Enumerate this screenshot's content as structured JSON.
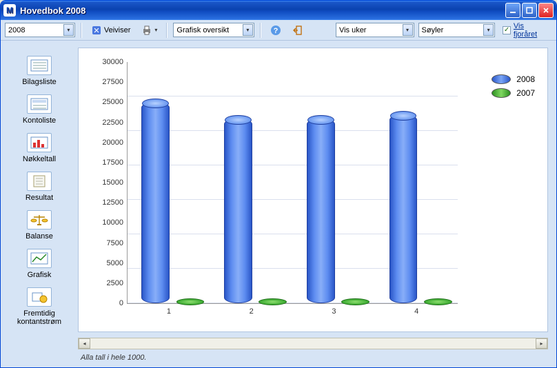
{
  "window": {
    "title": "Hovedbok 2008",
    "app_icon_letter": "M"
  },
  "toolbar": {
    "year_select": "2008",
    "veiviser_label": "Veiviser",
    "view_select": "Grafisk oversikt",
    "period_select": "Vis uker",
    "charttype_select": "Søyler",
    "show_prev_year_checked": true,
    "show_prev_year_label": "Vis fjoråret"
  },
  "sidebar": {
    "items": [
      {
        "key": "bilagsliste",
        "label": "Bilagsliste",
        "icon": "bilagsliste-icon"
      },
      {
        "key": "kontoliste",
        "label": "Kontoliste",
        "icon": "kontoliste-icon"
      },
      {
        "key": "nokkeltall",
        "label": "Nøkkeltall",
        "icon": "nokkeltall-icon"
      },
      {
        "key": "resultat",
        "label": "Resultat",
        "icon": "resultat-icon"
      },
      {
        "key": "balanse",
        "label": "Balanse",
        "icon": "balanse-icon"
      },
      {
        "key": "grafisk",
        "label": "Grafisk",
        "icon": "grafisk-icon"
      },
      {
        "key": "fremtidig",
        "label": "Fremtidig kontantstrøm",
        "icon": "fremtidig-icon"
      }
    ]
  },
  "chart_data": {
    "type": "bar",
    "categories": [
      "1",
      "2",
      "3",
      "4"
    ],
    "series": [
      {
        "name": "2008",
        "color": "#4a78e0",
        "values": [
          25000,
          23000,
          23000,
          23500
        ]
      },
      {
        "name": "2007",
        "color": "#3aa830",
        "values": [
          0,
          0,
          0,
          0
        ]
      }
    ],
    "ylim": [
      0,
      30000
    ],
    "yticks": [
      0,
      2500,
      5000,
      7500,
      10000,
      12500,
      15000,
      17500,
      20000,
      22500,
      25000,
      27500,
      30000
    ],
    "xlabel": "",
    "ylabel": "",
    "title": ""
  },
  "legend": [
    {
      "label": "2008",
      "color": "blue"
    },
    {
      "label": "2007",
      "color": "green"
    }
  ],
  "footer_note": "Alla tall i hele 1000."
}
